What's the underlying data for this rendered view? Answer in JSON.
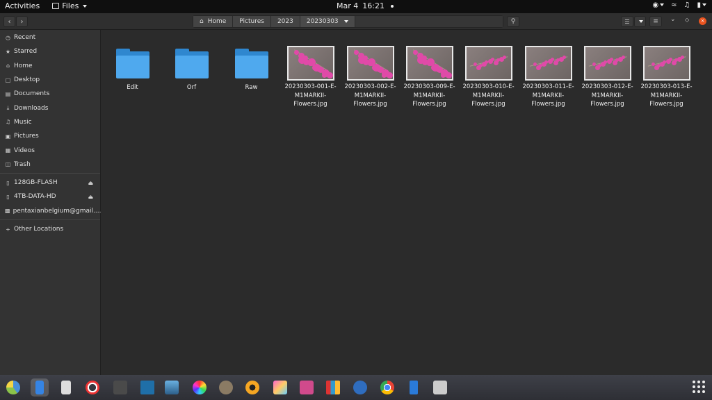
{
  "topbar": {
    "activities": "Activities",
    "app_menu": "Files",
    "date": "Mar 4",
    "time": "16:21"
  },
  "pathbar": {
    "crumbs": [
      "Home",
      "Pictures",
      "2023",
      "20230303"
    ]
  },
  "sidebar": {
    "places": [
      {
        "label": "Recent",
        "icon": "clock-icon"
      },
      {
        "label": "Starred",
        "icon": "star-icon"
      },
      {
        "label": "Home",
        "icon": "home-icon"
      },
      {
        "label": "Desktop",
        "icon": "desktop-icon"
      },
      {
        "label": "Documents",
        "icon": "document-icon"
      },
      {
        "label": "Downloads",
        "icon": "download-icon"
      },
      {
        "label": "Music",
        "icon": "music-icon"
      },
      {
        "label": "Pictures",
        "icon": "pictures-icon"
      },
      {
        "label": "Videos",
        "icon": "video-icon"
      },
      {
        "label": "Trash",
        "icon": "trash-icon"
      }
    ],
    "devices": [
      {
        "label": "128GB-FLASH",
        "icon": "drive-icon"
      },
      {
        "label": "4TB-DATA-HD",
        "icon": "drive-icon"
      },
      {
        "label": "pentaxianbelgium@gmail....",
        "icon": "cloud-account-icon"
      }
    ],
    "other": "Other Locations"
  },
  "files": {
    "folders": [
      "Edit",
      "Orf",
      "Raw"
    ],
    "images": [
      {
        "line1": "20230303-001-E-",
        "line2": "M1MARKII-",
        "line3": "Flowers.jpg"
      },
      {
        "line1": "20230303-002-E-",
        "line2": "M1MARKII-",
        "line3": "Flowers.jpg"
      },
      {
        "line1": "20230303-009-E-",
        "line2": "M1MARKII-",
        "line3": "Flowers.jpg"
      },
      {
        "line1": "20230303-010-E-",
        "line2": "M1MARKII-",
        "line3": "Flowers.jpg"
      },
      {
        "line1": "20230303-011-E-",
        "line2": "M1MARKII-",
        "line3": "Flowers.jpg"
      },
      {
        "line1": "20230303-012-E-",
        "line2": "M1MARKII-",
        "line3": "Flowers.jpg"
      },
      {
        "line1": "20230303-013-E-",
        "line2": "M1MARKII-",
        "line3": "Flowers.jpg"
      }
    ]
  },
  "colors": {
    "folder": "#4fa9ee",
    "flower": "#e04aa8"
  }
}
